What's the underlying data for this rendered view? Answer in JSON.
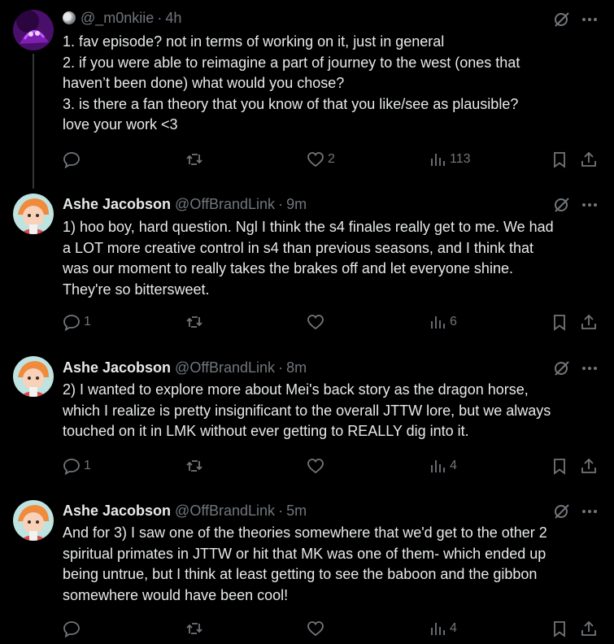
{
  "posts": [
    {
      "display_name": "",
      "handle": "@_m0nkiie",
      "time": "4h",
      "lines": [
        "1. fav episode? not in terms of working on it, just in general",
        "2. if you were able to reimagine a part of journey to the west (ones that",
        "haven’t been done) what would you chose?",
        "3. is there a fan theory that you know of that you like/see as plausible?",
        "love your work <3"
      ],
      "replies": "",
      "reposts": "",
      "likes": "2",
      "views": "113"
    },
    {
      "display_name": "Ashe Jacobson",
      "handle": "@OffBrandLink",
      "time": "9m",
      "lines": [
        "1) hoo boy, hard question. Ngl I think the s4 finales really get to me. We had",
        "a LOT more creative control in s4 than previous seasons, and I think that",
        "was our moment to really takes the brakes off and let everyone shine.",
        "They're so bittersweet."
      ],
      "replies": "1",
      "reposts": "",
      "likes": "",
      "views": "6"
    },
    {
      "display_name": "Ashe Jacobson",
      "handle": "@OffBrandLink",
      "time": "8m",
      "lines": [
        "2) I wanted to explore more about Mei's back story as the dragon horse,",
        "which I realize is pretty insignificant to the overall JTTW lore, but we always",
        "touched on it in LMK without ever getting to REALLY dig into it."
      ],
      "replies": "1",
      "reposts": "",
      "likes": "",
      "views": "4"
    },
    {
      "display_name": "Ashe Jacobson",
      "handle": "@OffBrandLink",
      "time": "5m",
      "lines": [
        "And for 3) I saw one of the theories somewhere that we'd get to the other 2",
        "spiritual primates in JTTW or hit that MK was one of them- which ended up",
        "being untrue, but I think at least getting to see the baboon and the gibbon",
        "somewhere would have been cool!"
      ],
      "replies": "",
      "reposts": "",
      "likes": "",
      "views": "4"
    }
  ],
  "icons": {
    "reply": "reply-icon",
    "repost": "repost-icon",
    "like": "heart-icon",
    "views": "views-icon",
    "bookmark": "bookmark-icon",
    "share": "share-icon",
    "grok": "grok-icon",
    "more": "more-icon"
  },
  "colors": {
    "background": "#000000",
    "text": "#e7e9ea",
    "muted": "#71767b"
  }
}
